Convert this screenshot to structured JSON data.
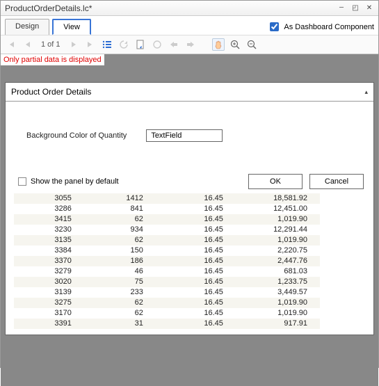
{
  "window": {
    "title": "ProductOrderDetails.lc*",
    "checkbox_label": "As Dashboard Component",
    "checkbox_checked": true
  },
  "tabs": {
    "design": "Design",
    "view": "View",
    "active": "view"
  },
  "toolbar": {
    "page_indicator": "1 of 1"
  },
  "warning": "Only partial data is displayed",
  "report": {
    "title": "Product Order Details",
    "param_label": "Background Color of Quantity",
    "textfield_value": "TextField",
    "show_panel_label": "Show the panel by default",
    "ok_label": "OK",
    "cancel_label": "Cancel"
  },
  "chart_data": {
    "type": "table",
    "columns": [
      "col1",
      "col2",
      "col3",
      "col4"
    ],
    "rows": [
      [
        "3055",
        "1412",
        "16.45",
        "18,581.92"
      ],
      [
        "3286",
        "841",
        "16.45",
        "12,451.00"
      ],
      [
        "3415",
        "62",
        "16.45",
        "1,019.90"
      ],
      [
        "3230",
        "934",
        "16.45",
        "12,291.44"
      ],
      [
        "3135",
        "62",
        "16.45",
        "1,019.90"
      ],
      [
        "3384",
        "150",
        "16.45",
        "2,220.75"
      ],
      [
        "3370",
        "186",
        "16.45",
        "2,447.76"
      ],
      [
        "3279",
        "46",
        "16.45",
        "681.03"
      ],
      [
        "3020",
        "75",
        "16.45",
        "1,233.75"
      ],
      [
        "3139",
        "233",
        "16.45",
        "3,449.57"
      ],
      [
        "3275",
        "62",
        "16.45",
        "1,019.90"
      ],
      [
        "3170",
        "62",
        "16.45",
        "1,019.90"
      ],
      [
        "3391",
        "31",
        "16.45",
        "917.91"
      ]
    ]
  }
}
